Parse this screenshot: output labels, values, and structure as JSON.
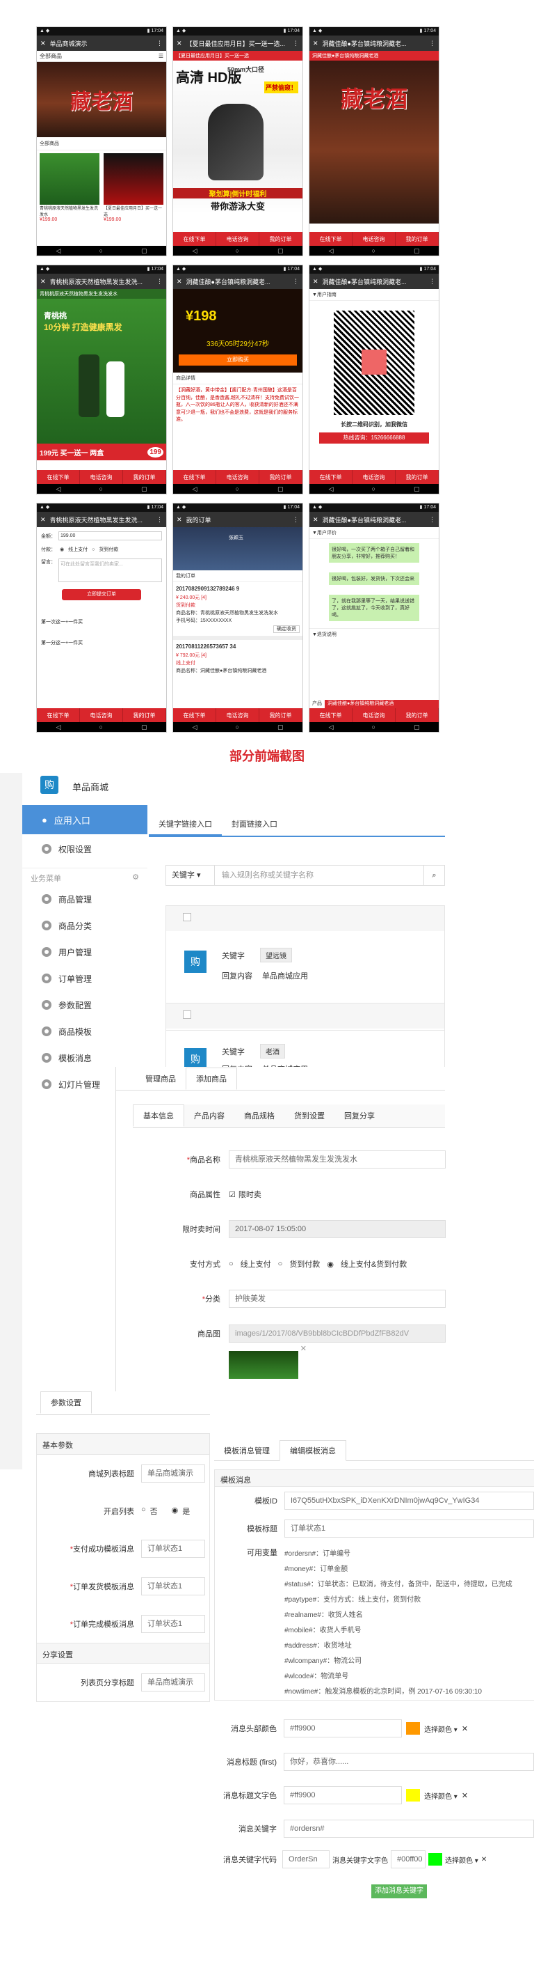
{
  "phones": {
    "p1": {
      "title": "单品商城演示",
      "nav": "全部商品",
      "section": "全部商品",
      "prod1_name": "青桃桃原液天然植物黑发生发洗发水",
      "prod1_price": "¥199.00",
      "prod2_name": "【夏日最佳应用月日】买一送一选",
      "prod2_price": "¥199.00",
      "logo": "藏老酒"
    },
    "p2": {
      "title": "【夏日最佳应用月日】买一送一选...",
      "banner": "【夏日最佳应用月日】买一送一选",
      "hd": "高清 HD版",
      "zoom": "50mm大口径",
      "tag": "严禁偷窥！",
      "bottom1": "聚划算|倒计时福利",
      "bottom2": "带你游泳大变"
    },
    "p3": {
      "title": "洞藏佳酿●茅台镇纯粮洞藏老...",
      "banner": "洞藏佳酿●茅台镇纯粮洞藏老酒",
      "logo": "藏老酒"
    },
    "p4": {
      "title": "青桃桃原液天然植物黑发生发洗...",
      "banner": "青桃桃原液天然植物黑发生发洗发水",
      "hl": "10分钟 打造健康黑发",
      "brand": "青桃桃",
      "price_l": "199元 买一送一 两盒",
      "price_r": "199"
    },
    "p5": {
      "title": "洞藏佳酿●茅台镇纯粮洞藏老...",
      "price": "¥198",
      "count": "336天05时29分47秒",
      "buy": "立即购买",
      "desc_title": "商品详情",
      "desc": "【洞藏好酒，黄中带金】【酱门配方·青州国酿】这酒是百分百纯，佳酿，是香造酱,越礼不过清样！支持免费试饮一瓶，八一次饮的86瓶让人的客人，收获清新的好酒还不满意可少退一瓶，我们也不会是浪费，这就是我们的服务标准。"
    },
    "p6": {
      "title": "洞藏佳酿●茅台镇纯粮洞藏老...",
      "nav": "▼用户指南",
      "qr_caption": "长按二维码识别，加我微信",
      "hotline": "热线咨询：15266666888"
    },
    "p7": {
      "title": "青桃桃原液天然植物黑发生发洗...",
      "amount_label": "金额：",
      "amount": "199.00",
      "pay_label": "付款：",
      "pay1": "线上支付",
      "pay2": "货到付款",
      "note_label": "留言：",
      "note_ph": "可在此处留言至我们的卖家...",
      "submit": "立即提交订单",
      "ann1": "第一次这一+一件买",
      "ann2": "第一分这一+一件买"
    },
    "p8": {
      "title": "我的订单",
      "user": "张颖玉",
      "tabs": "我的订单",
      "o1_no": "2017082909132789246 9",
      "o1_amount": "¥ 240.00元 [4]",
      "o1_status": "货到付款",
      "o1_name": "商品名称：青桃桃原液天然植物黑发生发洗发水",
      "o1_phone": "手机号码：15XXXXXXXX",
      "o2_no": "20170811226573657 34",
      "o2_amount": "¥ 792.00元 [4]",
      "o2_status": "线上支付",
      "o2_name": "商品名称：洞藏佳酿●茅台镇纯粮洞藏老酒",
      "btn": "确定收货"
    },
    "p9": {
      "title": "洞藏佳酿●茅台镇纯粮洞藏老...",
      "nav": "▼用户评价",
      "c1": "很好喝，一次买了两个箱子自己留着和朋友分享，非常好，推荐购买！",
      "c2": "很好喝，包装好，发货快，下次还会来",
      "c3": "了，就在我那里等了一天，结果说送错了，这就尴尬了，今天收到了，真好喝。",
      "nav2": "▼退货说明",
      "prod_label": "产品",
      "prod": "洞藏佳酿●茅台镇纯粮洞藏老酒"
    },
    "buttons": {
      "b1": "在线下单",
      "b2": "电话咨询",
      "b3": "我的订单"
    }
  },
  "caption": "部分前端截图",
  "admin1": {
    "app_name": "单品商城",
    "menu": {
      "app_entry": "应用入口",
      "permissions": "权限设置",
      "business_label": "业务菜单",
      "products": "商品管理",
      "categories": "商品分类",
      "users": "用户管理",
      "orders": "订单管理",
      "params": "参数配置",
      "templates": "商品模板",
      "tpl_msg": "模板消息",
      "slides": "幻灯片管理"
    },
    "tabs": {
      "keyword": "关键字链接入口",
      "cover": "封面链接入口"
    },
    "search": {
      "select": "关键字",
      "placeholder": "输入规则名称或关键字名称"
    },
    "rule1": {
      "kw_label": "关键字",
      "kw": "望远镜",
      "reply_label": "回复内容",
      "reply": "单品商城应用"
    },
    "rule2": {
      "kw_label": "关键字",
      "kw": "老酒",
      "reply_label": "回复内容",
      "reply": "单品商城应用"
    }
  },
  "admin2": {
    "top_tabs": {
      "manage": "管理商品",
      "add": "添加商品"
    },
    "sub_tabs": {
      "basic": "基本信息",
      "content": "产品内容",
      "spec": "商品规格",
      "shipping": "货到设置",
      "share": "回复分享"
    },
    "name_label": "商品名称",
    "name": "青桃桃原液天然植物黑发生发洗发水",
    "attr_label": "商品属性",
    "attr": "限时卖",
    "time_label": "限时卖时间",
    "time": "2017-08-07 15:05:00",
    "pay_label": "支付方式",
    "pay1": "线上支付",
    "pay2": "货到付款",
    "pay3": "线上支付&货到付款",
    "cat_label": "分类",
    "cat": "护肤美发",
    "img_label": "商品图",
    "img": "images/1/2017/08/VB9bbl8bCIcBDDfPbdZfFB82dV"
  },
  "admin3": {
    "title": "参数设置",
    "basic": "基本参数",
    "list_title_label": "商城列表标题",
    "list_title": "单品商城演示",
    "open_list_label": "开启列表",
    "open_no": "否",
    "open_yes": "是",
    "pay_tpl_label": "支付成功模板消息",
    "pay_tpl": "订单状态1",
    "ship_tpl_label": "订单发货模板消息",
    "ship_tpl": "订单状态1",
    "done_tpl_label": "订单完成模板消息",
    "done_tpl": "订单状态1",
    "share": "分享设置",
    "share_title_label": "列表页分享标题",
    "share_title": "单品商城演示"
  },
  "admin4": {
    "tabs": {
      "manage": "模板消息管理",
      "edit": "编辑模板消息"
    },
    "section": "模板消息",
    "id_label": "模板ID",
    "id": "I67Q55utHXbxSPK_iDXenKXrDNIm0jwAq9Cv_YwIG34",
    "title_label": "模板标题",
    "title": "订单状态1",
    "vars_label": "可用变量",
    "vars": [
      "#ordersn#：订单编号",
      "#money#：订单金额",
      "#status#：订单状态：已取消，待支付，备货中，配送中，待提取，已完成",
      "#paytype#：支付方式：线上支付，货到付款",
      "#realname#：收货人姓名",
      "#mobile#：收货人手机号",
      "#address#：收货地址",
      "#wlcompany#：物流公司",
      "#wlcode#：物流单号",
      "#nowtime#：触发消息模板的北京时间，例 2017-07-16 09:30:10"
    ],
    "topcolor_label": "消息头部颜色",
    "topcolor": "#ff9900",
    "pick": "选择颜色 ▾",
    "first_label": "消息标题 (first)",
    "first": "你好，恭喜你......",
    "firstcolor_label": "消息标题文字色",
    "firstcolor": "#ff9900",
    "kw_label": "消息关键字",
    "kw": "#ordersn#",
    "kwcode_label": "消息关键字代码",
    "kwcode": "OrderSn",
    "kwcolor_label": "消息关键字文字色",
    "kwcolor": "#00ff00",
    "add": "添加消息关键字"
  }
}
